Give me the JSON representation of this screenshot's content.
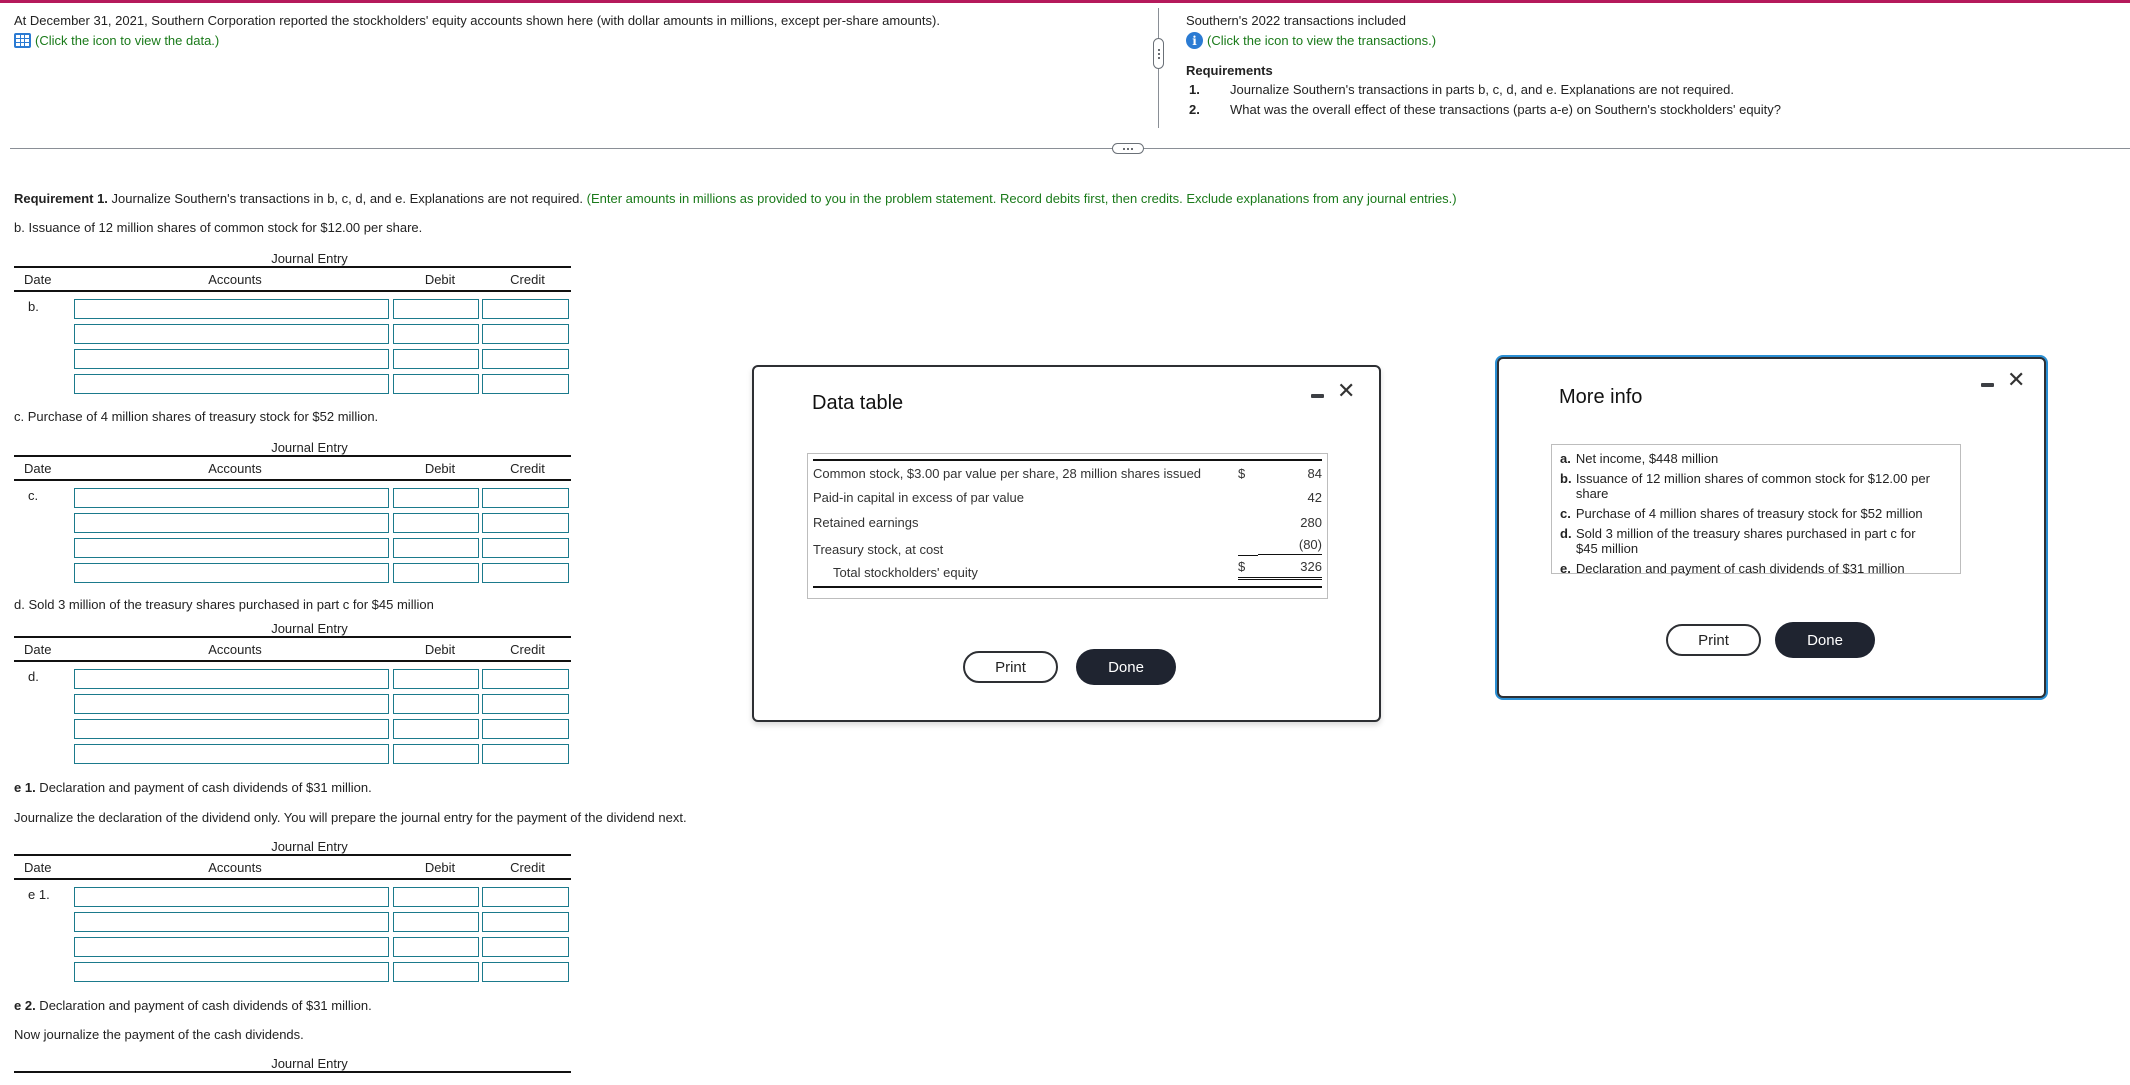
{
  "problem": {
    "statement": "At December 31, 2021, Southern Corporation reported the stockholders' equity accounts shown here (with dollar amounts in millions, except per-share amounts).",
    "data_link": "(Click the icon to view the data.)",
    "data_icon": "table-grid-icon"
  },
  "right_panel": {
    "transactions_intro": "Southern's 2022 transactions included",
    "transactions_link": "(Click the icon to view the transactions.)",
    "info_icon": "info-icon",
    "requirements_title": "Requirements",
    "requirements": [
      {
        "num": "1.",
        "text": "Journalize Southern's transactions in parts b, c, d, and e. Explanations are not required."
      },
      {
        "num": "2.",
        "text": "What was the overall effect of these transactions (parts a-e) on Southern's stockholders' equity?"
      }
    ]
  },
  "main": {
    "req1_bold": "Requirement 1.",
    "req1_text": " Journalize Southern's transactions in b, c, d, and e. Explanations are not required. ",
    "req1_instructions": "(Enter amounts in millions as provided to you in the problem statement. Record debits first, then credits. Exclude explanations from any journal entries.)",
    "journal": {
      "caption": "Journal Entry",
      "headers": {
        "date": "Date",
        "accounts": "Accounts",
        "debit": "Debit",
        "credit": "Credit"
      }
    },
    "parts": [
      {
        "id": "b",
        "title_bold": "b.",
        "title": " Issuance of 12 million shares of common stock for $12.00 per share.",
        "date_label": "b."
      },
      {
        "id": "c",
        "title_bold": "c.",
        "title": " Purchase of 4 million shares of treasury stock for $52 million.",
        "date_label": "c."
      },
      {
        "id": "d",
        "title_bold": "d.",
        "title": " Sold 3 million of the treasury shares purchased in part c for $45 million",
        "date_label": "d."
      },
      {
        "id": "e1",
        "title_bold": "e 1.",
        "title": " Declaration and payment of cash dividends of $31 million.",
        "instruction": "Journalize the declaration of the dividend only. You will prepare the journal entry for the payment of the dividend next.",
        "date_label": "e 1."
      },
      {
        "id": "e2",
        "title_bold": "e 2.",
        "title": " Declaration and payment of cash dividends of $31 million.",
        "instruction": "Now journalize the payment of the cash dividends."
      }
    ]
  },
  "data_modal": {
    "title": "Data table",
    "rows": [
      {
        "label": "Common stock, $3.00 par value per share, 28 million shares issued",
        "currency": "$",
        "value": "84"
      },
      {
        "label": "Paid-in capital in excess of par value",
        "currency": "",
        "value": "42"
      },
      {
        "label": "Retained earnings",
        "currency": "",
        "value": "280"
      },
      {
        "label": "Treasury stock, at cost",
        "currency": "",
        "value": "(80)"
      },
      {
        "label": "Total stockholders' equity",
        "currency": "$",
        "value": "326"
      }
    ],
    "print_label": "Print",
    "done_label": "Done"
  },
  "info_modal": {
    "title": "More info",
    "items": [
      {
        "key": "a.",
        "text": "Net income, $448 million"
      },
      {
        "key": "b.",
        "text": "Issuance of 12 million shares of common stock for $12.00 per share"
      },
      {
        "key": "c.",
        "text": "Purchase of 4 million shares of treasury stock for $52 million"
      },
      {
        "key": "d.",
        "text": "Sold 3 million of the treasury shares purchased in part c for $45 million"
      },
      {
        "key": "e.",
        "text": "Declaration and payment of cash dividends of $31 million"
      }
    ],
    "print_label": "Print",
    "done_label": "Done"
  },
  "colors": {
    "top_accent": "#b5195b",
    "link_green": "#1a7a1a",
    "icon_blue": "#2b7bd3",
    "input_border": "#1b7a8c",
    "done_button": "#1f2430",
    "active_modal_glow": "#2b8fd3"
  }
}
